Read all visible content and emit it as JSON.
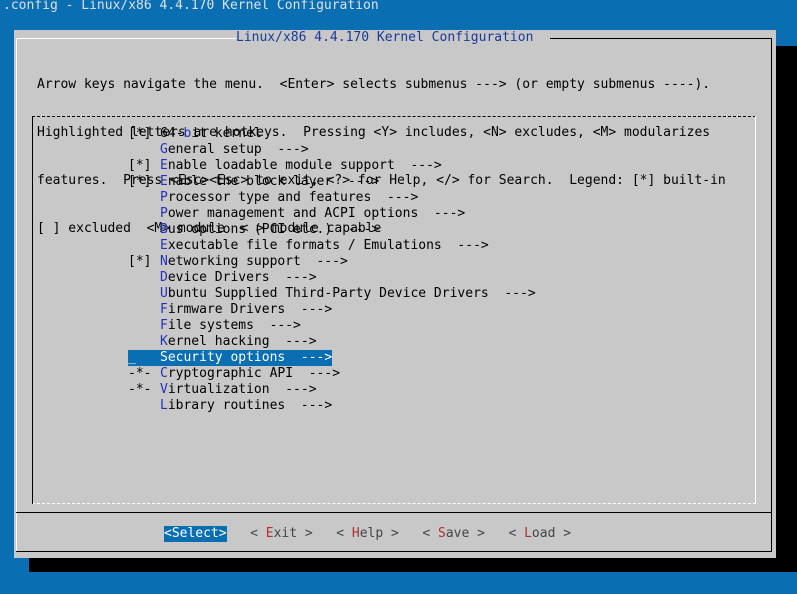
{
  "window": {
    "title": ".config - Linux/x86 4.4.170 Kernel Configuration"
  },
  "dialog": {
    "title": "Linux/x86 4.4.170 Kernel Configuration",
    "help_lines": [
      "Arrow keys navigate the menu.  <Enter> selects submenus ---> (or empty submenus ----).",
      "Highlighted letters are hotkeys.  Pressing <Y> includes, <N> excludes, <M> modularizes",
      "features.  Press <Esc><Esc> to exit, <?> for Help, </> for Search.  Legend: [*] built-in",
      "[ ] excluded  <M> module  < > module capable"
    ]
  },
  "menu": {
    "items": [
      {
        "prefix": "[*] ",
        "before": "64-",
        "hot": "b",
        "after": "it kernel"
      },
      {
        "prefix": "    ",
        "before": "",
        "hot": "G",
        "after": "eneral setup  --->"
      },
      {
        "prefix": "[*] ",
        "before": "",
        "hot": "E",
        "after": "nable loadable module support  --->"
      },
      {
        "prefix": "[*] ",
        "before": "",
        "hot": "E",
        "after": "nable the block layer  --->"
      },
      {
        "prefix": "    ",
        "before": "",
        "hot": "P",
        "after": "rocessor type and features  --->"
      },
      {
        "prefix": "    ",
        "before": "",
        "hot": "P",
        "after": "ower management and ACPI options  --->"
      },
      {
        "prefix": "    ",
        "before": "",
        "hot": "B",
        "after": "us options (PCI etc.)  --->"
      },
      {
        "prefix": "    ",
        "before": "",
        "hot": "E",
        "after": "xecutable file formats / Emulations  --->"
      },
      {
        "prefix": "[*] ",
        "before": "",
        "hot": "N",
        "after": "etworking support  --->"
      },
      {
        "prefix": "    ",
        "before": "",
        "hot": "D",
        "after": "evice Drivers  --->"
      },
      {
        "prefix": "    ",
        "before": "",
        "hot": "U",
        "after": "buntu Supplied Third-Party Device Drivers  --->"
      },
      {
        "prefix": "    ",
        "before": "",
        "hot": "F",
        "after": "irmware Drivers  --->"
      },
      {
        "prefix": "    ",
        "before": "",
        "hot": "F",
        "after": "ile systems  --->"
      },
      {
        "prefix": "    ",
        "before": "",
        "hot": "K",
        "after": "ernel hacking  --->"
      },
      {
        "prefix": "_   ",
        "before": "",
        "hot": "S",
        "after": "ecurity options  --->"
      },
      {
        "prefix": "-*- ",
        "before": "",
        "hot": "C",
        "after": "ryptographic API  --->"
      },
      {
        "prefix": "-*- ",
        "before": "",
        "hot": "V",
        "after": "irtualization  --->"
      },
      {
        "prefix": "    ",
        "before": "",
        "hot": "L",
        "after": "ibrary routines  --->"
      }
    ],
    "selected_index": 14
  },
  "buttons": [
    {
      "open": "<",
      "hot": "S",
      "rest": "elect",
      "close": ">"
    },
    {
      "open": "< ",
      "hot": "E",
      "rest": "xit",
      "close": " >"
    },
    {
      "open": "< ",
      "hot": "H",
      "rest": "elp",
      "close": " >"
    },
    {
      "open": "< ",
      "hot": "S",
      "rest": "ave",
      "close": " >"
    },
    {
      "open": "< ",
      "hot": "L",
      "rest": "oad",
      "close": " >"
    }
  ],
  "colors": {
    "background": "#0a6eb3",
    "dialog": "#c8c8c8",
    "hotkey": "#2233bb",
    "button_hotkey": "#b03030"
  }
}
